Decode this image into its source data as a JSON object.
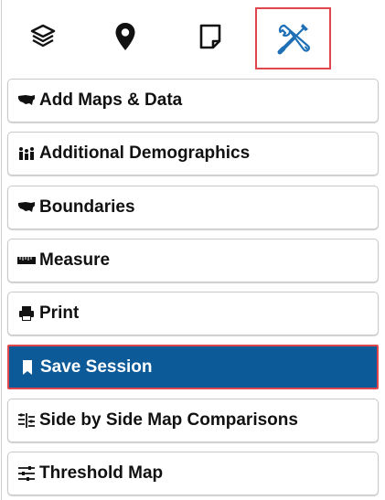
{
  "toolbar": {
    "tabs": [
      {
        "icon": "layers-icon"
      },
      {
        "icon": "map-pin-icon"
      },
      {
        "icon": "note-icon"
      },
      {
        "icon": "tools-icon",
        "active": true
      }
    ]
  },
  "menu": {
    "items": [
      {
        "label": "Add Maps & Data",
        "icon": "usa-map-icon"
      },
      {
        "label": "Additional Demographics",
        "icon": "people-icon"
      },
      {
        "label": "Boundaries",
        "icon": "usa-map-icon"
      },
      {
        "label": "Measure",
        "icon": "ruler-icon"
      },
      {
        "label": "Print",
        "icon": "printer-icon"
      },
      {
        "label": "Save Session",
        "icon": "bookmark-icon",
        "active": true
      },
      {
        "label": "Side by Side Map Comparisons",
        "icon": "side-by-side-icon"
      },
      {
        "label": "Threshold Map",
        "icon": "sliders-icon"
      }
    ]
  },
  "colors": {
    "active_background": "#0d5a99",
    "highlight_border": "#e0474c",
    "tools_icon": "#1e6fb5"
  }
}
